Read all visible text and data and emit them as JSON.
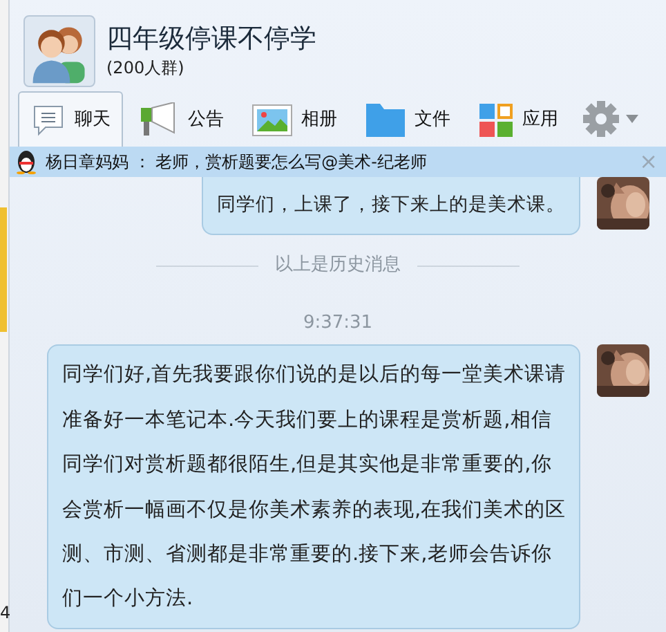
{
  "background_window": {
    "text": "4"
  },
  "group": {
    "name": "四年级停课不停学",
    "member_count": "(200人群)"
  },
  "tabs": [
    {
      "label": "聊天",
      "kind": "chat",
      "selected": true
    },
    {
      "label": "公告",
      "kind": "notice",
      "selected": false
    },
    {
      "label": "相册",
      "kind": "album",
      "selected": false
    },
    {
      "label": "文件",
      "kind": "file",
      "selected": false
    },
    {
      "label": "应用",
      "kind": "apps",
      "selected": false
    }
  ],
  "notice_bar": {
    "text": "杨日章妈妈 ： 老师，赏析题要怎么写@美术-纪老师",
    "close": "×"
  },
  "messages": [
    {
      "kind": "bubble",
      "text": "同学们，上课了，接下来上的是美术课。"
    },
    {
      "kind": "divider",
      "text": "以上是历史消息"
    },
    {
      "kind": "time",
      "text": "9:37:31"
    },
    {
      "kind": "bubble",
      "text": "同学们好,首先我要跟你们说的是以后的每一堂美术课请准备好一本笔记本.今天我们要上的课程是赏析题,相信同学们对赏析题都很陌生,但是其实他是非常重要的,你会赏析一幅画不仅是你美术素养的表现,在我们美术的区测、市测、省测都是非常重要的.接下来,老师会告诉你们一个小方法."
    }
  ]
}
